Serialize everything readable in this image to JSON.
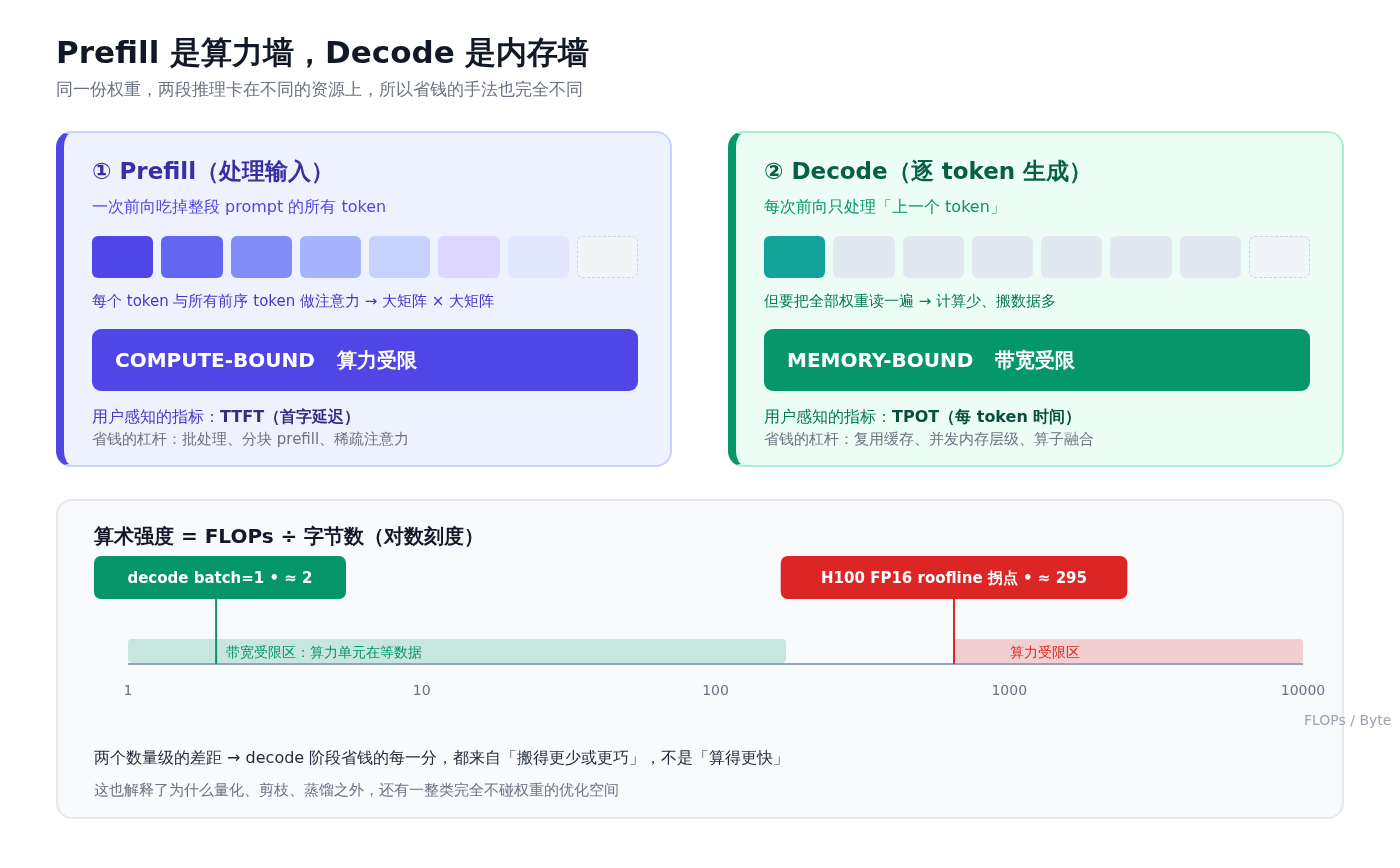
{
  "header": {
    "title": "Prefill 是算力墙，Decode 是内存墙",
    "subtitle": "同一份权重，两段推理卡在不同的资源上，所以省钱的手法也完全不同"
  },
  "cards": [
    {
      "kind": "compute",
      "title": "① Prefill（处理输入）",
      "subtitle": "一次前向吃掉整段 prompt 的所有 token",
      "tokens": [
        {
          "kind": "token",
          "color": "#4f46e5"
        },
        {
          "kind": "token",
          "color": "#6366f1"
        },
        {
          "kind": "token",
          "color": "#818cf8"
        },
        {
          "kind": "token",
          "color": "#a5b4fc"
        },
        {
          "kind": "token",
          "color": "#c7d2fe"
        },
        {
          "kind": "token",
          "color": "#ddd6fe"
        },
        {
          "kind": "token",
          "color": "#e0e7ff"
        },
        {
          "kind": "pending",
          "color": "#f3f4f6"
        }
      ],
      "note": "每个 token 与所有前序 token 做注意力 → 大矩阵 × 大矩阵",
      "badge": [
        "COMPUTE-BOUND",
        "算力受限"
      ],
      "metric": "用户感知的指标：**TTFT（首字延迟）**",
      "levers": "省钱的杠杆：批处理、分块 prefill、稀疏注意力"
    },
    {
      "kind": "memory",
      "title": "② Decode（逐 token 生成）",
      "subtitle": "每次前向只处理「上一个 token」",
      "tokens": [
        {
          "kind": "token",
          "color": "#14a39a"
        },
        {
          "kind": "token",
          "color": "#e2e8f0"
        },
        {
          "kind": "token",
          "color": "#e2e8f0"
        },
        {
          "kind": "token",
          "color": "#e2e8f0"
        },
        {
          "kind": "token",
          "color": "#e2e8f0"
        },
        {
          "kind": "token",
          "color": "#e2e8f0"
        },
        {
          "kind": "token",
          "color": "#e2e8f0"
        },
        {
          "kind": "pending",
          "color": "#f1f5f9"
        }
      ],
      "note": "但要把全部权重读一遍 → 计算少、搬数据多",
      "badge": [
        "MEMORY-BOUND",
        "带宽受限"
      ],
      "metric": "用户感知的指标：**TPOT（每 token 时间）**",
      "levers": "省钱的杠杆：复用缓存、并发内存层级、算子融合"
    }
  ],
  "intensity": {
    "title": "算术强度 = FLOPs ÷ 字节数（对数刻度）",
    "scale": {
      "ticks": [
        "1",
        "10",
        "100",
        "1000",
        "10000"
      ],
      "unit": "FLOPs / Byte",
      "zones": [
        {
          "kind": "start",
          "level": 0.56,
          "text": "带宽受限区：算力单元在等数据",
          "color": "#059669"
        },
        {
          "kind": "end",
          "level": 0.297,
          "text": "算力受限区",
          "color": "#dc2626"
        }
      ],
      "markers": [
        {
          "level": 0.075,
          "text": "decode batch=1 • ≈ 2",
          "color": "#059669"
        },
        {
          "level": 0.703,
          "text": "H100 FP16 roofline 拐点 • ≈ 295",
          "color": "#dc2626"
        }
      ]
    },
    "conclusion": "两个数量级的差距 → decode 阶段省钱的每一分，都来自「搬得更少或更巧」，不是「算得更快」",
    "footnote": "这也解释了为什么量化、剪枝、蒸馏之外，还有一整类完全不碰权重的优化空间"
  }
}
